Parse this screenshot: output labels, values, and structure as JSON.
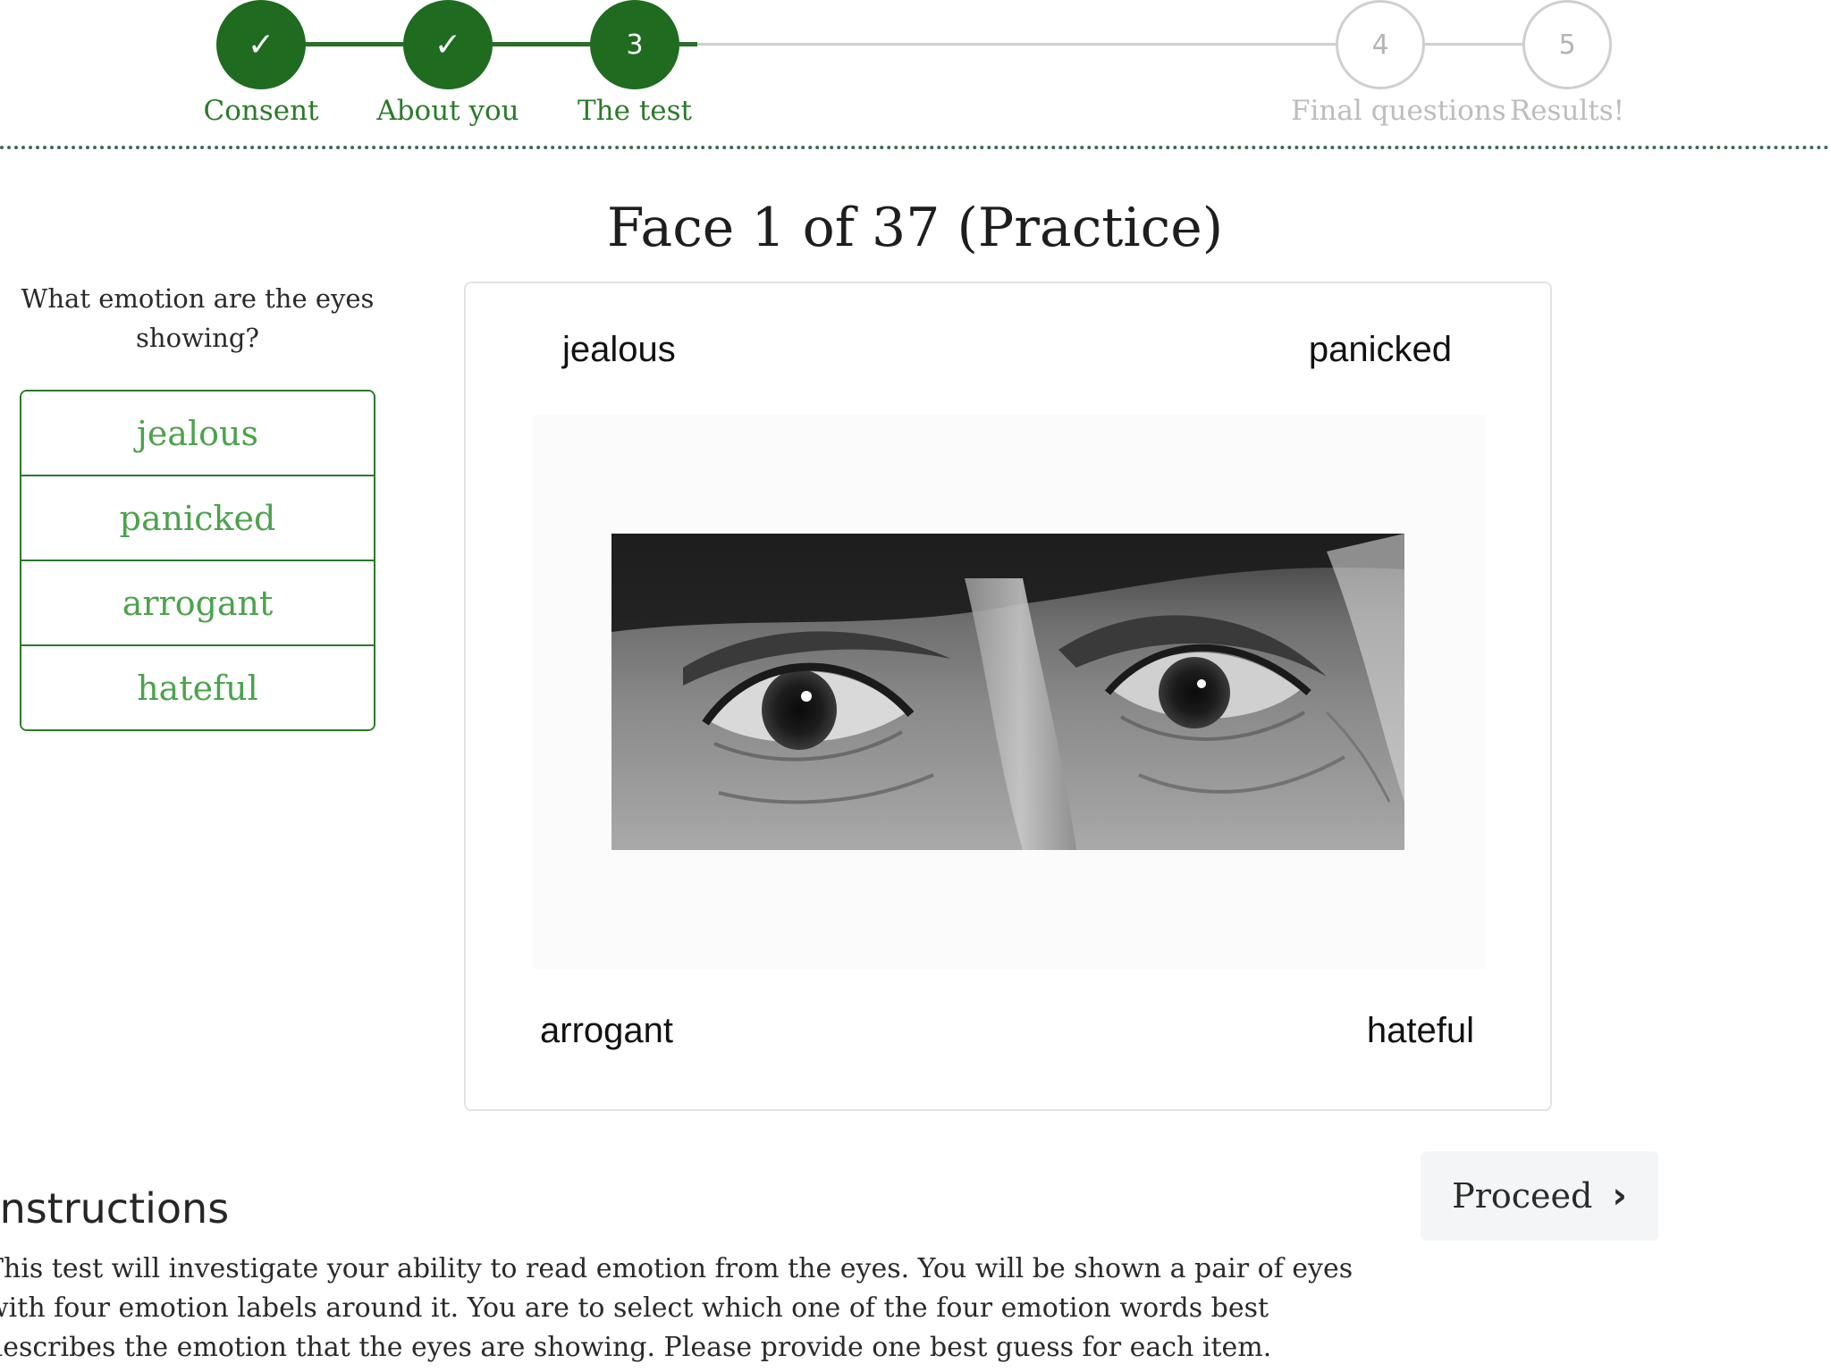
{
  "stepper": {
    "steps": [
      {
        "label": "Consent",
        "marker": "✓",
        "state": "complete"
      },
      {
        "label": "About you",
        "marker": "✓",
        "state": "complete"
      },
      {
        "label": "The test",
        "marker": "3",
        "state": "current"
      },
      {
        "label": "Final questions",
        "marker": "4",
        "state": "future"
      },
      {
        "label": "Results!",
        "marker": "5",
        "state": "future"
      }
    ]
  },
  "title": "Face 1 of 37 (Practice)",
  "question": "What emotion are the eyes showing?",
  "options": [
    "jealous",
    "panicked",
    "arrogant",
    "hateful"
  ],
  "stimulus": {
    "top_left": "jealous",
    "top_right": "panicked",
    "bottom_left": "arrogant",
    "bottom_right": "hateful"
  },
  "proceed": {
    "label": "Proceed",
    "icon": "chevron-right-icon"
  },
  "instructions": {
    "heading": "Instructions",
    "text": "This test will investigate your ability to read emotion from the eyes. You will be shown a pair of eyes with four emotion labels around it. You are to select which one of the four emotion words best describes the emotion that the eyes are showing. Please provide one best guess for each item."
  },
  "colors": {
    "accent": "#1f6b1f",
    "option_text": "#4ca24c",
    "inactive": "#cfcfcf"
  }
}
